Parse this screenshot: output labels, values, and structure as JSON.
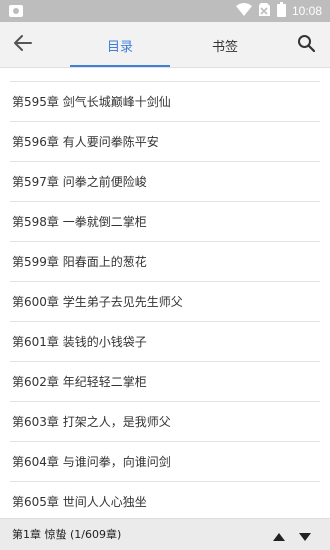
{
  "status_bar": {
    "time": "10:08",
    "icons": [
      "notification-icon",
      "wifi-icon",
      "no-sim-icon",
      "battery-icon"
    ]
  },
  "header": {
    "tabs": [
      {
        "label": "目录",
        "active": true
      },
      {
        "label": "书签",
        "active": false
      }
    ],
    "icons": [
      "back-arrow-icon",
      "search-icon"
    ]
  },
  "chapters": [
    "第595章 剑气长城巅峰十剑仙",
    "第596章 有人要问拳陈平安",
    "第597章 问拳之前便险峻",
    "第598章 一拳就倒二掌柜",
    "第599章 阳春面上的葱花",
    "第600章 学生弟子去见先生师父",
    "第601章 装钱的小钱袋子",
    "第602章 年纪轻轻二掌柜",
    "第603章 打架之人，是我师父",
    "第604章 与谁问拳，向谁问剑",
    "第605章 世间人人心独坐"
  ],
  "footer": {
    "current": "第1章 惊蛰 (1/609章)",
    "icons": [
      "arrow-up-icon",
      "arrow-down-icon"
    ]
  },
  "colors": {
    "accent": "#3f7fd8",
    "status_bar": "#bdbdbd",
    "header_bg": "#f2f2f2",
    "footer_bg": "#ebebeb"
  }
}
